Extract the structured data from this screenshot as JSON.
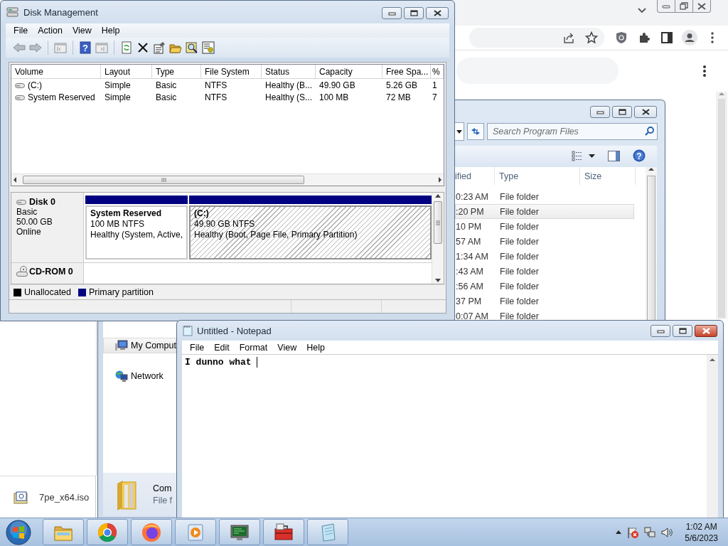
{
  "disk_management": {
    "title": "Disk Management",
    "menu": [
      "File",
      "Action",
      "View",
      "Help"
    ],
    "help_icon_text": "?",
    "columns": [
      "Volume",
      "Layout",
      "Type",
      "File System",
      "Status",
      "Capacity",
      "Free Spa...",
      "%"
    ],
    "volumes": [
      {
        "cells": [
          "(C:)",
          "Simple",
          "Basic",
          "NTFS",
          "Healthy (B...",
          "49.90 GB",
          "5.26 GB",
          "1"
        ]
      },
      {
        "cells": [
          "System Reserved",
          "Simple",
          "Basic",
          "NTFS",
          "Healthy (S...",
          "100 MB",
          "72 MB",
          "7"
        ]
      }
    ],
    "disks": [
      {
        "kind": "disk",
        "name": "Disk 0",
        "details": [
          "Basic",
          "50.00 GB",
          "Online"
        ],
        "partitions": [
          {
            "name": "System Reserved",
            "size": "100 MB NTFS",
            "status": "Healthy (System, Active,",
            "selected": false
          },
          {
            "name": "(C:)",
            "size": "49.90 GB NTFS",
            "status": "Healthy (Boot, Page File, Primary Partition)",
            "selected": true
          }
        ]
      },
      {
        "kind": "cdrom",
        "name": "CD-ROM 0"
      }
    ],
    "legend": [
      {
        "label": "Unallocated",
        "color": "#000000"
      },
      {
        "label": "Primary partition",
        "color": "#000080"
      }
    ]
  },
  "explorer": {
    "search": {
      "placeholder": "Search Program Files"
    },
    "help_icon_text": "?",
    "columns": [
      "ified",
      "Type",
      "Size"
    ],
    "rows": [
      {
        "modified": "0:23 AM",
        "type": "File folder",
        "selected": false
      },
      {
        "modified": ":20 PM",
        "type": "File folder",
        "selected": true
      },
      {
        "modified": "10 PM",
        "type": "File folder",
        "selected": false
      },
      {
        "modified": "57 AM",
        "type": "File folder",
        "selected": false
      },
      {
        "modified": "1:34 AM",
        "type": "File folder",
        "selected": false
      },
      {
        "modified": ":43 AM",
        "type": "File folder",
        "selected": false
      },
      {
        "modified": ":56 AM",
        "type": "File folder",
        "selected": false
      },
      {
        "modified": "37 PM",
        "type": "File folder",
        "selected": false
      },
      {
        "modified": "0:07 AM",
        "type": "File folder",
        "selected": false
      }
    ],
    "nav": [
      {
        "label": "My Comput",
        "selected": true
      },
      {
        "label": "Network",
        "selected": false
      }
    ],
    "details": {
      "name": "Com",
      "type": "File f"
    }
  },
  "downloads": [
    {
      "name": "7pe_x64.iso"
    }
  ],
  "notepad": {
    "title": "Untitled - Notepad",
    "menu": [
      "File",
      "Edit",
      "Format",
      "View",
      "Help"
    ],
    "text": "I dunno what "
  },
  "taskbar": {
    "clock": {
      "time": "1:02 AM",
      "date": "5/6/2023"
    }
  }
}
